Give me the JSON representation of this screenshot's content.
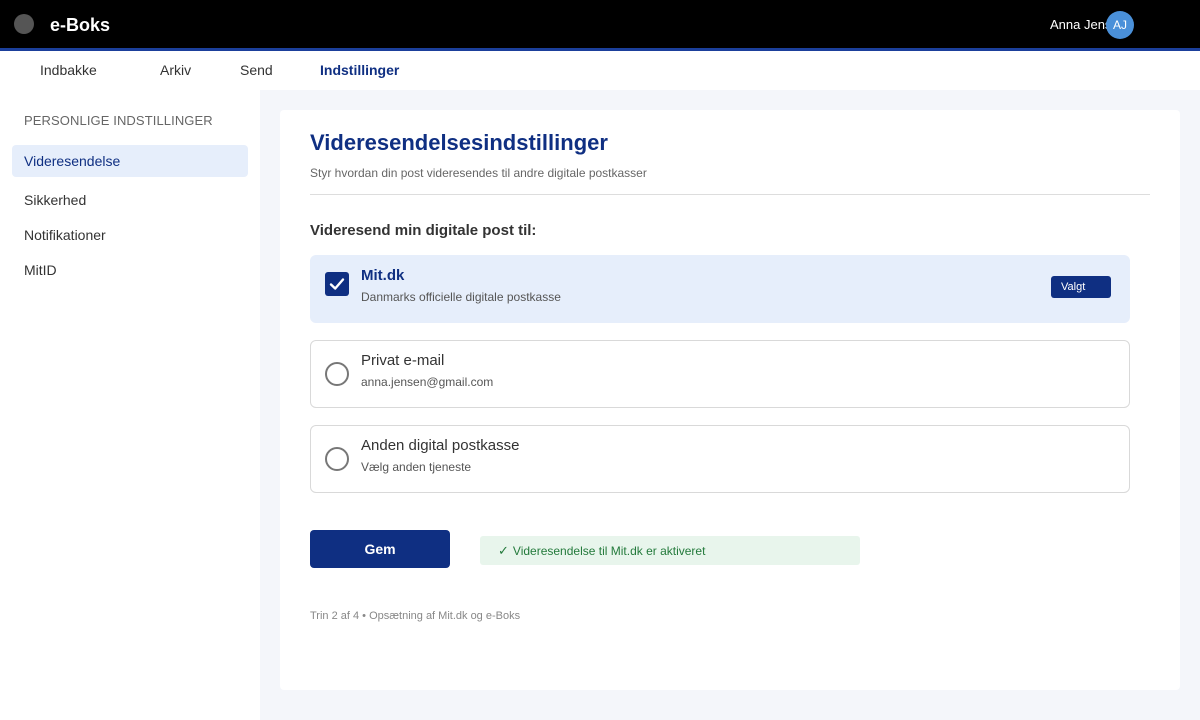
{
  "header": {
    "brand": "e-Boks",
    "user_name": "Anna Jensen",
    "avatar_initials": "AJ"
  },
  "nav": {
    "items": [
      {
        "label": "Indbakke",
        "active": false
      },
      {
        "label": "Arkiv",
        "active": false
      },
      {
        "label": "Send",
        "active": false
      },
      {
        "label": "Indstillinger",
        "active": true
      }
    ]
  },
  "sidebar": {
    "heading": "PERSONLIGE INDSTILLINGER",
    "items": [
      {
        "label": "Videresendelse",
        "active": true
      },
      {
        "label": "Sikkerhed",
        "active": false
      },
      {
        "label": "Notifikationer",
        "active": false
      },
      {
        "label": "MitID",
        "active": false
      }
    ]
  },
  "main": {
    "title": "Videresendelsesindstillinger",
    "subtitle": "Styr hvordan din post videresendes til andre digitale postkasser",
    "section_label": "Videresend min digitale post til:",
    "options": [
      {
        "title": "Mit.dk",
        "description": "Danmarks officielle digitale postkasse",
        "selected": true,
        "badge": "Valgt"
      },
      {
        "title": "Privat e-mail",
        "description": "anna.jensen@gmail.com",
        "selected": false
      },
      {
        "title": "Anden digital postkasse",
        "description": "Vælg anden tjeneste",
        "selected": false
      }
    ],
    "save_label": "Gem",
    "status_check": "✓",
    "status_text": "Videresendelse til Mit.dk er aktiveret",
    "footer_note": "Trin 2 af 4 • Opsætning af Mit.dk og e-Boks"
  },
  "colors": {
    "topbar": "#000000",
    "accent": "#0f2f82",
    "selected_bg": "#e6eefb",
    "success_bg": "#e8f5ec",
    "success_text": "#237a3b"
  }
}
